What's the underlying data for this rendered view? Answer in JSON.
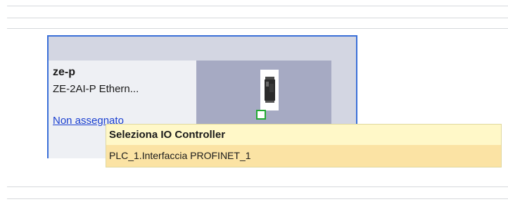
{
  "device": {
    "name": "ze-p",
    "type": "ZE-2AI-P Ethern...",
    "assignment_link": "Non assegnato",
    "module_icon": "plc-module-icon",
    "port_icon": "profinet-port-icon"
  },
  "popup": {
    "header": "Seleziona IO Controller",
    "options": [
      "PLC_1.Interfaccia PROFINET_1"
    ]
  },
  "colors": {
    "selection_border": "#3a6fd8",
    "port_border": "#22aa33",
    "link": "#1a3fd0",
    "popup_header_bg": "#fff8c8",
    "popup_item_bg": "#fbe3a4"
  }
}
